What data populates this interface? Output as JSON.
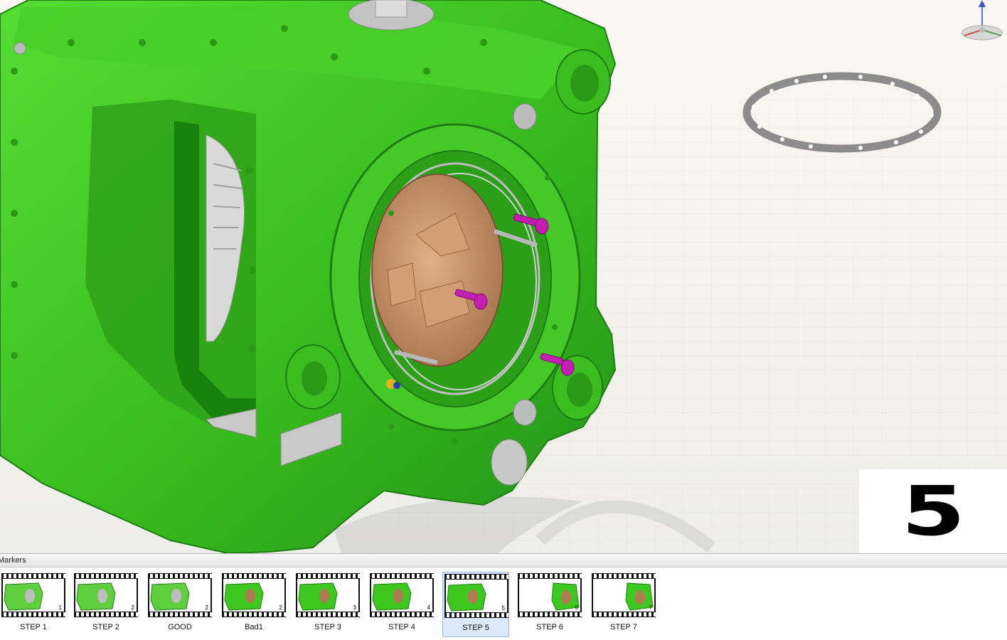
{
  "viewport": {
    "step_number": "5",
    "colors": {
      "housing": "#3cc81e",
      "housing_dark": "#1f8a12",
      "cover": "#c08a62",
      "bolts": "#c020b0",
      "gasket": "#8a8a8a"
    },
    "view_cube_icon": "view-cube-icon"
  },
  "markers": {
    "header": "Markers",
    "selected": "STEP 5",
    "items": [
      {
        "label": "STEP 1",
        "index": "1",
        "thumb": "housing"
      },
      {
        "label": "STEP 2",
        "index": "2",
        "thumb": "housing"
      },
      {
        "label": "GOOD",
        "index": "2",
        "thumb": "housing"
      },
      {
        "label": "Bad1",
        "index": "2",
        "thumb": "housing-green"
      },
      {
        "label": "STEP 3",
        "index": "3",
        "thumb": "housing-green"
      },
      {
        "label": "STEP 4",
        "index": "4",
        "thumb": "housing-green"
      },
      {
        "label": "STEP 5",
        "index": "5",
        "thumb": "housing-green"
      },
      {
        "label": "STEP 6",
        "index": "5",
        "thumb": "housing-rear"
      },
      {
        "label": "STEP 7",
        "index": "7",
        "thumb": "housing-rear"
      }
    ]
  }
}
